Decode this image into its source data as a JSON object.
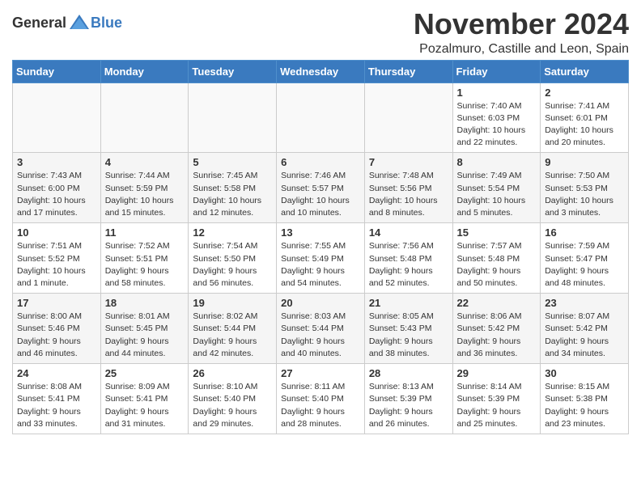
{
  "header": {
    "logo_general": "General",
    "logo_blue": "Blue",
    "title": "November 2024",
    "location": "Pozalmuro, Castille and Leon, Spain"
  },
  "days_of_week": [
    "Sunday",
    "Monday",
    "Tuesday",
    "Wednesday",
    "Thursday",
    "Friday",
    "Saturday"
  ],
  "weeks": [
    [
      {
        "day": "",
        "info": ""
      },
      {
        "day": "",
        "info": ""
      },
      {
        "day": "",
        "info": ""
      },
      {
        "day": "",
        "info": ""
      },
      {
        "day": "",
        "info": ""
      },
      {
        "day": "1",
        "info": "Sunrise: 7:40 AM\nSunset: 6:03 PM\nDaylight: 10 hours and 22 minutes."
      },
      {
        "day": "2",
        "info": "Sunrise: 7:41 AM\nSunset: 6:01 PM\nDaylight: 10 hours and 20 minutes."
      }
    ],
    [
      {
        "day": "3",
        "info": "Sunrise: 7:43 AM\nSunset: 6:00 PM\nDaylight: 10 hours and 17 minutes."
      },
      {
        "day": "4",
        "info": "Sunrise: 7:44 AM\nSunset: 5:59 PM\nDaylight: 10 hours and 15 minutes."
      },
      {
        "day": "5",
        "info": "Sunrise: 7:45 AM\nSunset: 5:58 PM\nDaylight: 10 hours and 12 minutes."
      },
      {
        "day": "6",
        "info": "Sunrise: 7:46 AM\nSunset: 5:57 PM\nDaylight: 10 hours and 10 minutes."
      },
      {
        "day": "7",
        "info": "Sunrise: 7:48 AM\nSunset: 5:56 PM\nDaylight: 10 hours and 8 minutes."
      },
      {
        "day": "8",
        "info": "Sunrise: 7:49 AM\nSunset: 5:54 PM\nDaylight: 10 hours and 5 minutes."
      },
      {
        "day": "9",
        "info": "Sunrise: 7:50 AM\nSunset: 5:53 PM\nDaylight: 10 hours and 3 minutes."
      }
    ],
    [
      {
        "day": "10",
        "info": "Sunrise: 7:51 AM\nSunset: 5:52 PM\nDaylight: 10 hours and 1 minute."
      },
      {
        "day": "11",
        "info": "Sunrise: 7:52 AM\nSunset: 5:51 PM\nDaylight: 9 hours and 58 minutes."
      },
      {
        "day": "12",
        "info": "Sunrise: 7:54 AM\nSunset: 5:50 PM\nDaylight: 9 hours and 56 minutes."
      },
      {
        "day": "13",
        "info": "Sunrise: 7:55 AM\nSunset: 5:49 PM\nDaylight: 9 hours and 54 minutes."
      },
      {
        "day": "14",
        "info": "Sunrise: 7:56 AM\nSunset: 5:48 PM\nDaylight: 9 hours and 52 minutes."
      },
      {
        "day": "15",
        "info": "Sunrise: 7:57 AM\nSunset: 5:48 PM\nDaylight: 9 hours and 50 minutes."
      },
      {
        "day": "16",
        "info": "Sunrise: 7:59 AM\nSunset: 5:47 PM\nDaylight: 9 hours and 48 minutes."
      }
    ],
    [
      {
        "day": "17",
        "info": "Sunrise: 8:00 AM\nSunset: 5:46 PM\nDaylight: 9 hours and 46 minutes."
      },
      {
        "day": "18",
        "info": "Sunrise: 8:01 AM\nSunset: 5:45 PM\nDaylight: 9 hours and 44 minutes."
      },
      {
        "day": "19",
        "info": "Sunrise: 8:02 AM\nSunset: 5:44 PM\nDaylight: 9 hours and 42 minutes."
      },
      {
        "day": "20",
        "info": "Sunrise: 8:03 AM\nSunset: 5:44 PM\nDaylight: 9 hours and 40 minutes."
      },
      {
        "day": "21",
        "info": "Sunrise: 8:05 AM\nSunset: 5:43 PM\nDaylight: 9 hours and 38 minutes."
      },
      {
        "day": "22",
        "info": "Sunrise: 8:06 AM\nSunset: 5:42 PM\nDaylight: 9 hours and 36 minutes."
      },
      {
        "day": "23",
        "info": "Sunrise: 8:07 AM\nSunset: 5:42 PM\nDaylight: 9 hours and 34 minutes."
      }
    ],
    [
      {
        "day": "24",
        "info": "Sunrise: 8:08 AM\nSunset: 5:41 PM\nDaylight: 9 hours and 33 minutes."
      },
      {
        "day": "25",
        "info": "Sunrise: 8:09 AM\nSunset: 5:41 PM\nDaylight: 9 hours and 31 minutes."
      },
      {
        "day": "26",
        "info": "Sunrise: 8:10 AM\nSunset: 5:40 PM\nDaylight: 9 hours and 29 minutes."
      },
      {
        "day": "27",
        "info": "Sunrise: 8:11 AM\nSunset: 5:40 PM\nDaylight: 9 hours and 28 minutes."
      },
      {
        "day": "28",
        "info": "Sunrise: 8:13 AM\nSunset: 5:39 PM\nDaylight: 9 hours and 26 minutes."
      },
      {
        "day": "29",
        "info": "Sunrise: 8:14 AM\nSunset: 5:39 PM\nDaylight: 9 hours and 25 minutes."
      },
      {
        "day": "30",
        "info": "Sunrise: 8:15 AM\nSunset: 5:38 PM\nDaylight: 9 hours and 23 minutes."
      }
    ]
  ]
}
